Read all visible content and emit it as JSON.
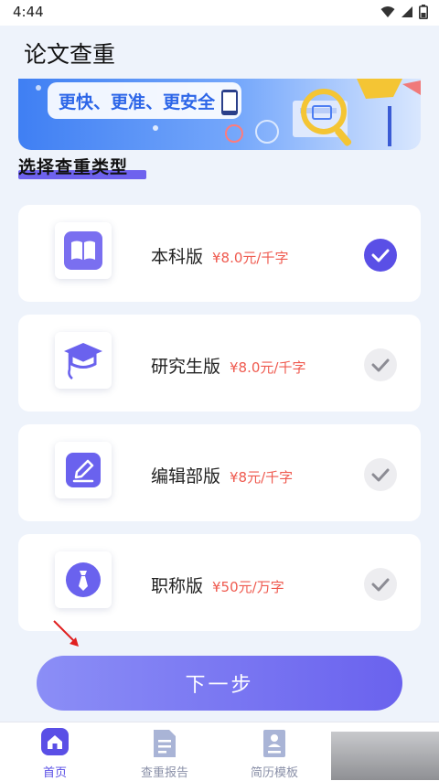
{
  "status_bar": {
    "time": "4:44"
  },
  "header": {
    "title": "论文查重"
  },
  "banner": {
    "slogan": "更快、更准、更安全"
  },
  "section": {
    "title": "选择查重类型"
  },
  "options": [
    {
      "name": "本科版",
      "price": "¥8.0元/千字",
      "selected": true,
      "icon": "book-icon"
    },
    {
      "name": "研究生版",
      "price": "¥8.0元/千字",
      "selected": false,
      "icon": "graduation-cap-icon"
    },
    {
      "name": "编辑部版",
      "price": "¥8元/千字",
      "selected": false,
      "icon": "edit-pen-icon"
    },
    {
      "name": "职称版",
      "price": "¥50元/万字",
      "selected": false,
      "icon": "tie-icon"
    }
  ],
  "next_button": {
    "label": "下一步"
  },
  "tabs": [
    {
      "label": "首页",
      "active": true,
      "icon": "home-icon"
    },
    {
      "label": "查重报告",
      "active": false,
      "icon": "report-icon"
    },
    {
      "label": "简历模板",
      "active": false,
      "icon": "resume-icon"
    }
  ],
  "colors": {
    "accent": "#5a4fe6",
    "price": "#ef5a4f",
    "background": "#eef3fb"
  }
}
